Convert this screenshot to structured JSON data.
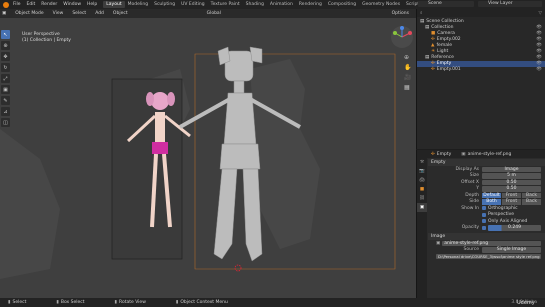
{
  "topbar": {
    "menus": [
      "File",
      "Edit",
      "Render",
      "Window",
      "Help"
    ],
    "workspace_tabs": [
      "Layout",
      "Modeling",
      "Sculpting",
      "UV Editing",
      "Texture Paint",
      "Shading",
      "Animation",
      "Rendering",
      "Compositing",
      "Geometry Nodes",
      "Scripting"
    ],
    "active_tab": "Layout",
    "scene_label": "Scene",
    "view_layer_label": "View Layer"
  },
  "viewport_header": {
    "mode": "Object Mode",
    "menus": [
      "View",
      "Select",
      "Add",
      "Object"
    ],
    "transform": "Global",
    "options": "Options"
  },
  "viewport_info": {
    "line1": "User Perspective",
    "line2": "(1) Collection | Empty"
  },
  "outliner": {
    "items": [
      {
        "label": "Scene Collection",
        "indent": 0
      },
      {
        "label": "Collection",
        "indent": 1
      },
      {
        "label": "Camera",
        "indent": 2
      },
      {
        "label": "Empty.002",
        "indent": 2
      },
      {
        "label": "female",
        "indent": 2
      },
      {
        "label": "Light",
        "indent": 2
      },
      {
        "label": "Reference",
        "indent": 1
      },
      {
        "label": "Empty",
        "indent": 2,
        "selected": true
      },
      {
        "label": "Empty.001",
        "indent": 2
      }
    ]
  },
  "properties": {
    "object_name": "Empty",
    "data_name": "anime-style-ref.png",
    "section_empty": "Empty",
    "display_as_label": "Display As",
    "display_as_value": "Image",
    "size_label": "Size",
    "size_value": "5 m",
    "offset_x_label": "Offset X",
    "offset_x_value": "0.50",
    "offset_y_label": "Y",
    "offset_y_value": "0.50",
    "depth_label": "Depth",
    "depth_options": [
      "Default",
      "Front",
      "Back"
    ],
    "side_label": "Side",
    "side_options": [
      "Both",
      "Front",
      "Back"
    ],
    "show_in_label": "Show In",
    "show_in_options": [
      "Orthographic",
      "Perspective",
      "Only Axis Aligned"
    ],
    "opacity_label": "Opacity",
    "opacity_value": "0.249",
    "section_image": "Image",
    "image_name": "anime-style-ref.png",
    "source_label": "Source",
    "source_value": "Single Image",
    "filepath": "D:\\Personal drive\\COURSE_3\\wsol\\anime style ref.png"
  },
  "statusbar": {
    "select": "Select",
    "box_select": "Box Select",
    "rotate_view": "Rotate View",
    "context_menu": "Object Context Menu",
    "version": "3.6.0 Alpha",
    "watermark": "Udemy"
  },
  "colors": {
    "accent": "#4772b3",
    "viewport_bg": "#3f3f3f",
    "selection": "#334d80"
  }
}
